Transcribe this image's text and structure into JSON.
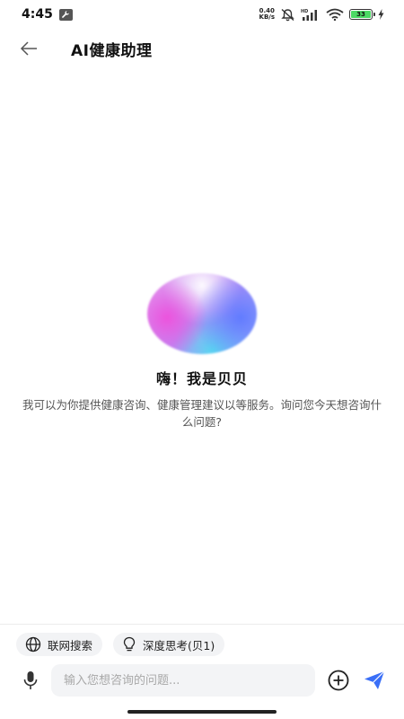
{
  "status_bar": {
    "time": "4:45",
    "net_speed_value": "0.40",
    "net_speed_unit": "KB/s",
    "battery_level": "33",
    "icons": [
      "wrench-icon",
      "mute-bell-icon",
      "hd-signal-icon",
      "wifi-icon",
      "battery-icon",
      "charging-icon"
    ]
  },
  "header": {
    "title": "AI健康助理",
    "back_icon": "arrow-left-icon"
  },
  "welcome": {
    "greeting": "嗨！我是贝贝",
    "intro": "我可以为你提供健康咨询、健康管理建议以等服务。询问您今天想咨询什么问题?"
  },
  "chips": [
    {
      "label": "联网搜索",
      "icon": "globe-icon"
    },
    {
      "label": "深度思考(贝1)",
      "icon": "lightbulb-icon"
    }
  ],
  "composer": {
    "placeholder": "输入您想咨询的问题...",
    "value": "",
    "mic_icon": "microphone-icon",
    "add_icon": "plus-circle-icon",
    "send_icon": "send-icon"
  },
  "colors": {
    "accent": "#3a6ff7",
    "chip_bg": "#f2f3f5",
    "input_bg": "#f3f4f6",
    "battery_green": "#4cd964"
  }
}
